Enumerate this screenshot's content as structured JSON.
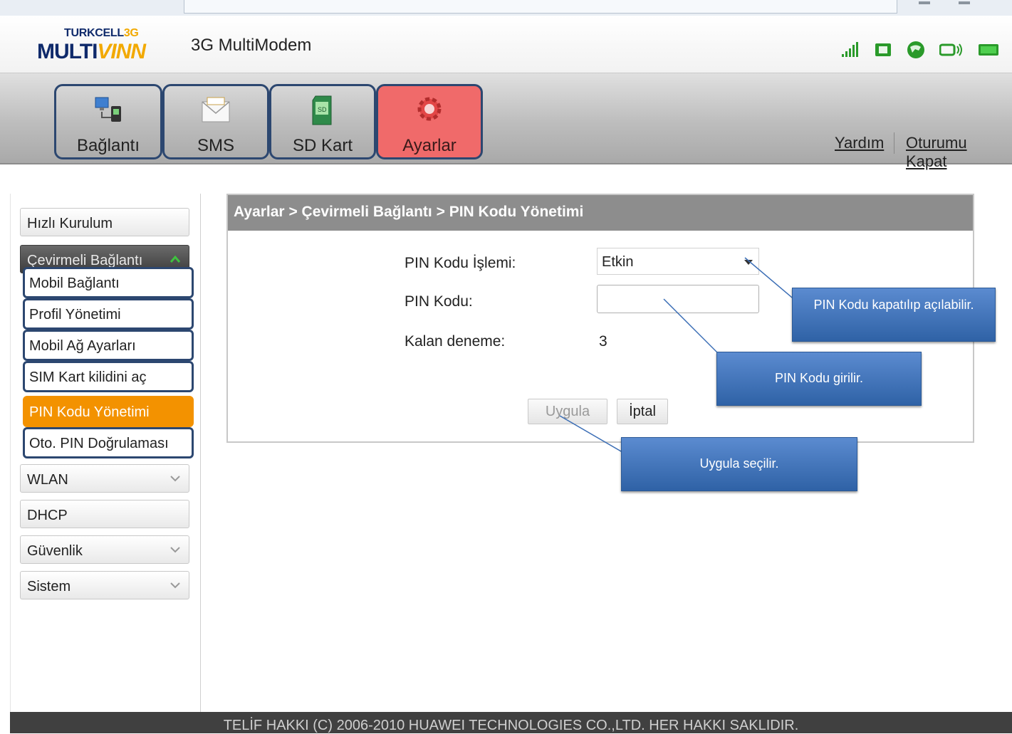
{
  "header": {
    "logo_top": "TURKCELL",
    "logo_top_accent": "3G",
    "logo_bottom": "MULTI",
    "logo_bottom_accent": "VINN",
    "app_title": "3G MultiModem"
  },
  "status_icons": [
    "signal-strength-icon",
    "sim-card-icon",
    "globe-icon",
    "modem-connection-icon",
    "battery-icon"
  ],
  "nav": {
    "tabs": [
      {
        "label": "Bağlantı",
        "icon": "network-connection-icon"
      },
      {
        "label": "SMS",
        "icon": "envelope-icon"
      },
      {
        "label": "SD Kart",
        "icon": "sd-card-icon"
      },
      {
        "label": "Ayarlar",
        "icon": "settings-gear-icon",
        "active": true
      }
    ],
    "help": "Yardım",
    "logout": "Oturumu Kapat"
  },
  "sidebar": {
    "quick_setup": "Hızlı Kurulum",
    "dialup": {
      "label": "Çevirmeli Bağlantı",
      "items": [
        "Mobil Bağlantı",
        "Profil Yönetimi",
        "Mobil Ağ Ayarları",
        "SIM Kart kilidini aç",
        "PIN Kodu Yönetimi",
        "Oto. PIN Doğrulaması"
      ],
      "active_item": "PIN Kodu Yönetimi"
    },
    "wlan": "WLAN",
    "dhcp": "DHCP",
    "security": "Güvenlik",
    "system": "Sistem"
  },
  "main": {
    "breadcrumb": "Ayarlar > Çevirmeli Bağlantı > PIN Kodu Yönetimi",
    "pin_operation_label": "PIN Kodu İşlemi:",
    "pin_operation_value": "Etkin",
    "pin_code_label": "PIN Kodu:",
    "pin_code_value": "",
    "attempts_label": "Kalan deneme:",
    "attempts_value": "3",
    "apply_button": "Uygula",
    "cancel_button": "İptal"
  },
  "callouts": {
    "toggle": "PIN Kodu kapatılıp açılabilir.",
    "enter": "PIN Kodu girilir.",
    "apply": "Uygula seçilir."
  },
  "footer": {
    "copyright": "TELİF HAKKI (C) 2006-2010 HUAWEI TECHNOLOGIES CO.,LTD. HER HAKKI SAKLIDIR."
  },
  "colors": {
    "active_tab": "#f06a6a",
    "active_menu": "#f39200",
    "highlight_border": "#2c4770",
    "callout": "#3a6db5"
  }
}
